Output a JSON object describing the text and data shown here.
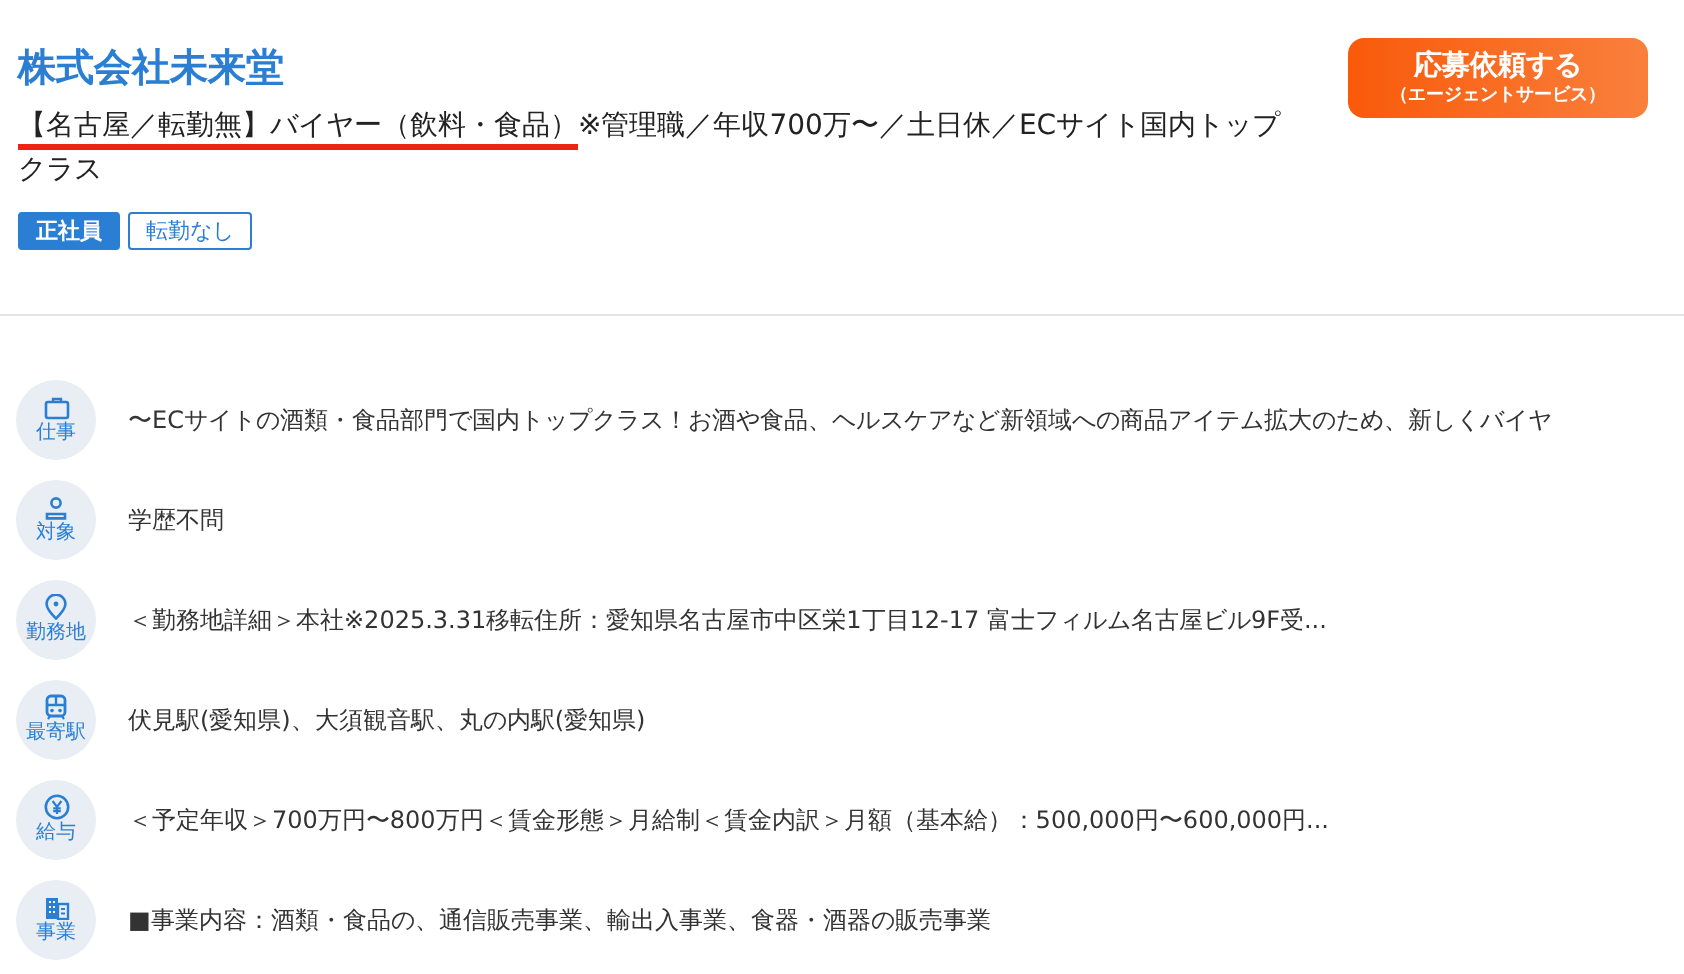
{
  "company": "株式会社未来堂",
  "job_title": {
    "highlight": "【名古屋／転勤無】バイヤー（飲料・食品）",
    "rest": "※管理職／年収700万〜／土日休／ECサイト国内トップクラス"
  },
  "tags": [
    {
      "label": "正社員",
      "kind": "solid"
    },
    {
      "label": "転勤なし",
      "kind": "outline"
    }
  ],
  "apply_button": {
    "label": "応募依頼する",
    "sublabel": "（エージェントサービス）"
  },
  "details": [
    {
      "kind": "job",
      "label": "仕事",
      "text": "〜ECサイトの酒類・食品部門で国内トップクラス！お酒や食品、ヘルスケアなど新領域への商品アイテム拡大のため、新しくバイヤ"
    },
    {
      "kind": "target",
      "label": "対象",
      "text": "学歴不問"
    },
    {
      "kind": "location",
      "label": "勤務地",
      "text": "＜勤務地詳細＞本社※2025.3.31移転住所：愛知県名古屋市中区栄1丁目12-17 富士フィルム名古屋ビル9F受..."
    },
    {
      "kind": "station",
      "label": "最寄駅",
      "text": "伏見駅(愛知県)、大須観音駅、丸の内駅(愛知県)"
    },
    {
      "kind": "salary",
      "label": "給与",
      "text": "＜予定年収＞700万円〜800万円＜賃金形態＞月給制＜賃金内訳＞月額（基本給）：500,000円〜600,000円..."
    },
    {
      "kind": "business",
      "label": "事業",
      "text": "■事業内容：酒類・食品の、通信販売事業、輸出入事業、食器・酒器の販売事業"
    }
  ]
}
